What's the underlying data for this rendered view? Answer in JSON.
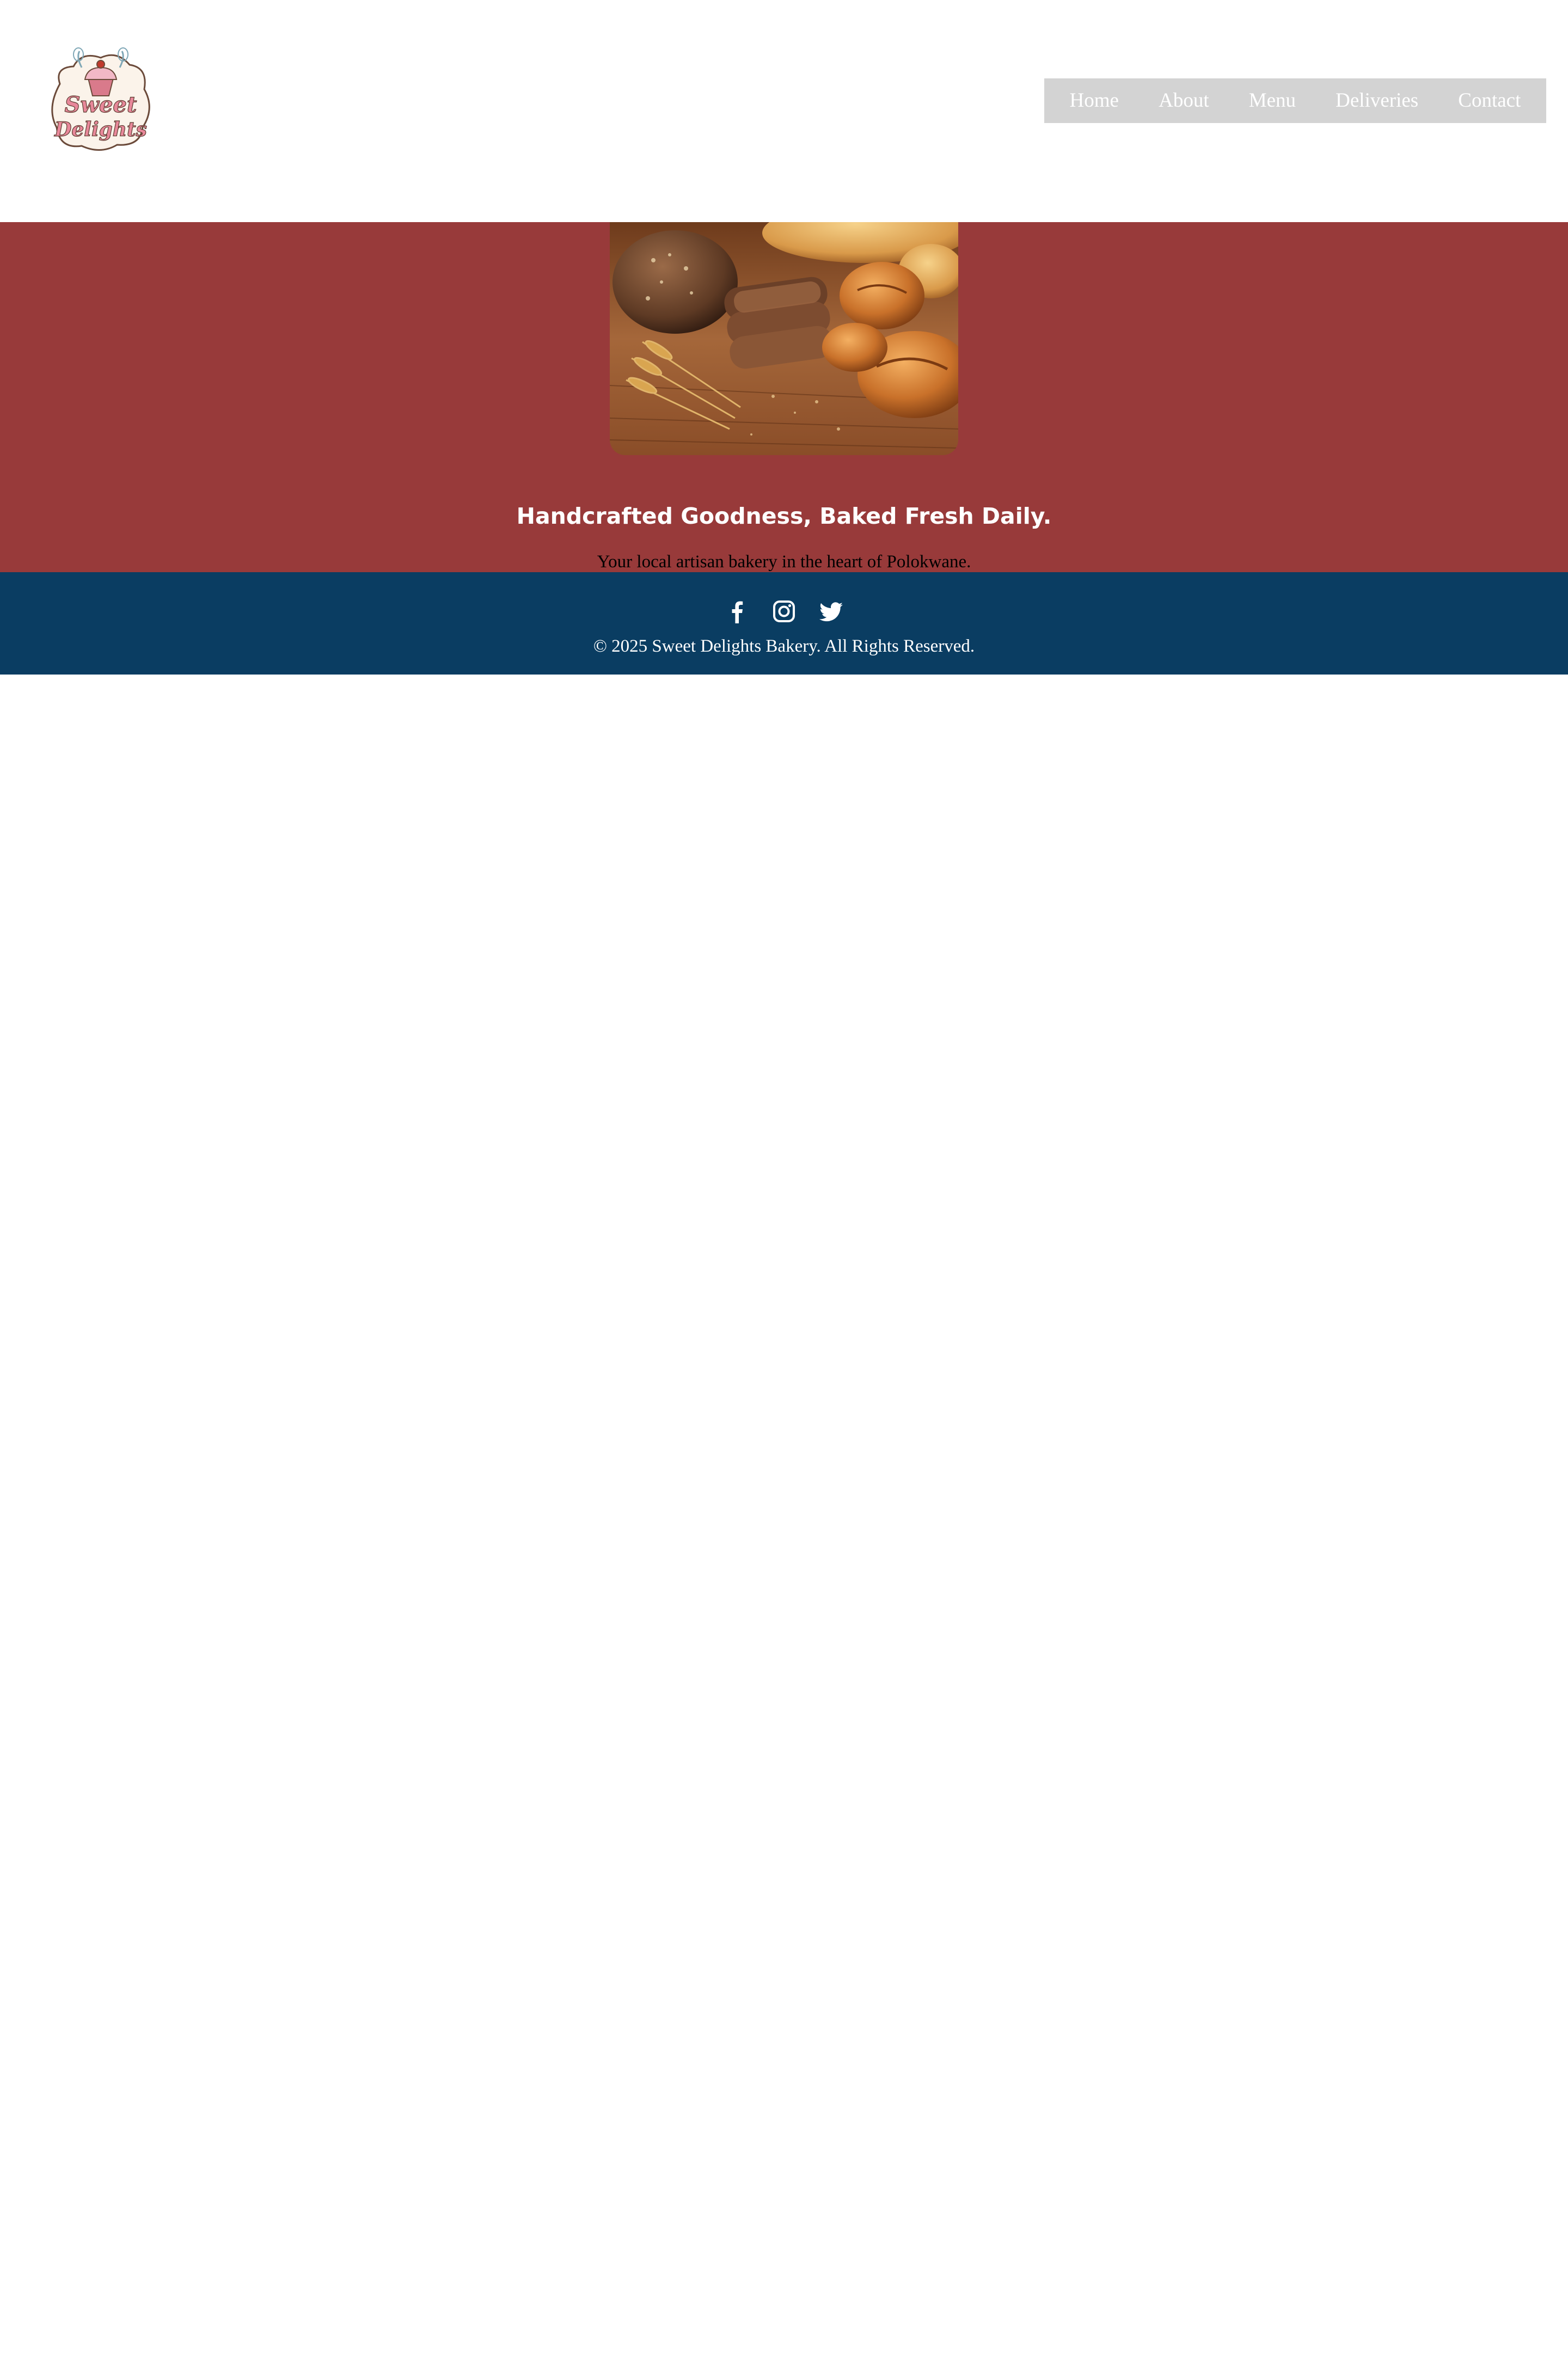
{
  "header": {
    "logo_alt": "Sweet Delights",
    "logo_text_line1": "Sweet",
    "logo_text_line2": "Delights",
    "nav": [
      {
        "label": "Home"
      },
      {
        "label": "About"
      },
      {
        "label": "Menu"
      },
      {
        "label": "Deliveries"
      },
      {
        "label": "Contact"
      }
    ]
  },
  "hero": {
    "image_subject": "assorted artisan breads with wheat stalks on a wooden table",
    "title": "Handcrafted Goodness, Baked Fresh Daily.",
    "subtitle": "Your local artisan bakery in the heart of Polokwane."
  },
  "footer": {
    "social_icons": [
      "facebook-icon",
      "instagram-icon",
      "twitter-icon"
    ],
    "copyright": "© 2025 Sweet Delights Bakery. All Rights Reserved."
  },
  "colors": {
    "hero_bg": "#983a3a",
    "footer_bg": "#0a3d62",
    "nav_bg": "#d3d3d3",
    "text_light": "#ffffff"
  }
}
